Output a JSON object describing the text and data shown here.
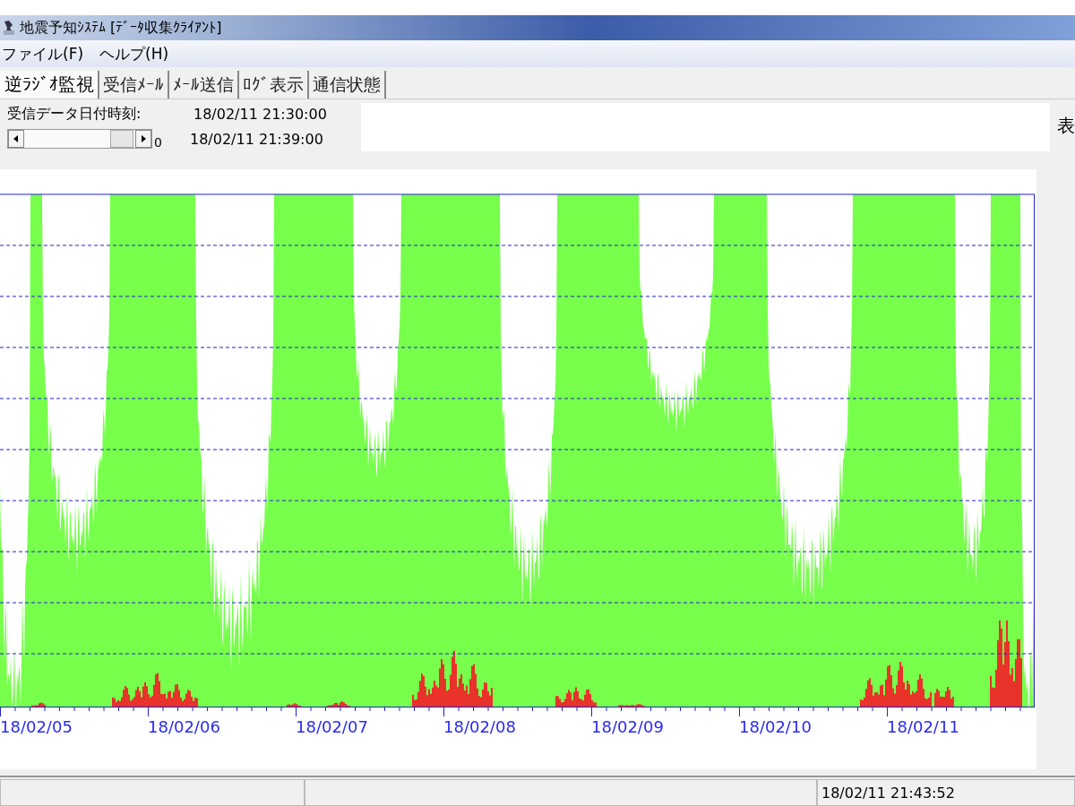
{
  "window": {
    "title": "地震予知ｼｽﾃﾑ [ﾃﾞｰﾀ収集ｸﾗｲｱﾝﾄ]"
  },
  "menu": [
    "ファイル(F)",
    "ヘルプ(H)"
  ],
  "tabs": [
    {
      "label": "逆ﾗｼﾞｵ監視",
      "selected": true
    },
    {
      "label": "受信ﾒｰﾙ",
      "selected": false
    },
    {
      "label": "ﾒｰﾙ送信",
      "selected": false
    },
    {
      "label": "ﾛｸﾞ表示",
      "selected": false
    },
    {
      "label": "通信状態",
      "selected": false
    }
  ],
  "info": {
    "label": "受信データ日付時刻:",
    "received_time": "18/02/11 21:30:00",
    "slider_value": "0",
    "current_time": "18/02/11 21:39:00",
    "side_label": "表"
  },
  "chart": {
    "x_labels": [
      "18/02/05",
      "18/02/06",
      "18/02/07",
      "18/02/08",
      "18/02/09",
      "18/02/10",
      "18/02/11"
    ]
  },
  "status_bar": {
    "time": "18/02/11 21:43:52"
  }
}
